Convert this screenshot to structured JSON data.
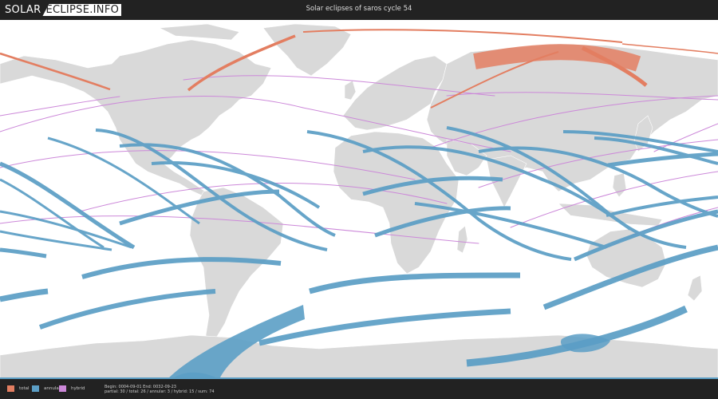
{
  "header": {
    "logo_part1": "SOLAR",
    "logo_part2": "ECLIPSE.INFO",
    "title": "Solar eclipses of saros cycle 54"
  },
  "legend": [
    {
      "label": "total",
      "color": "#e37e61"
    },
    {
      "label": "annular",
      "color": "#5b9ec5"
    },
    {
      "label": "hybrid",
      "color": "#cc88d9"
    }
  ],
  "footer": {
    "line1": "Begin: 0004-09-01 End: 0032-09-23",
    "line2": "partial: 30 / total: 26 / annular: 3 / hybrid: 15 / sum: 74"
  },
  "colors": {
    "land": "#d9d9d9",
    "land_border": "#ffffff",
    "ocean": "#ffffff",
    "total": "#e37e61",
    "annular": "#5b9ec5",
    "hybrid": "#cc88d9"
  }
}
